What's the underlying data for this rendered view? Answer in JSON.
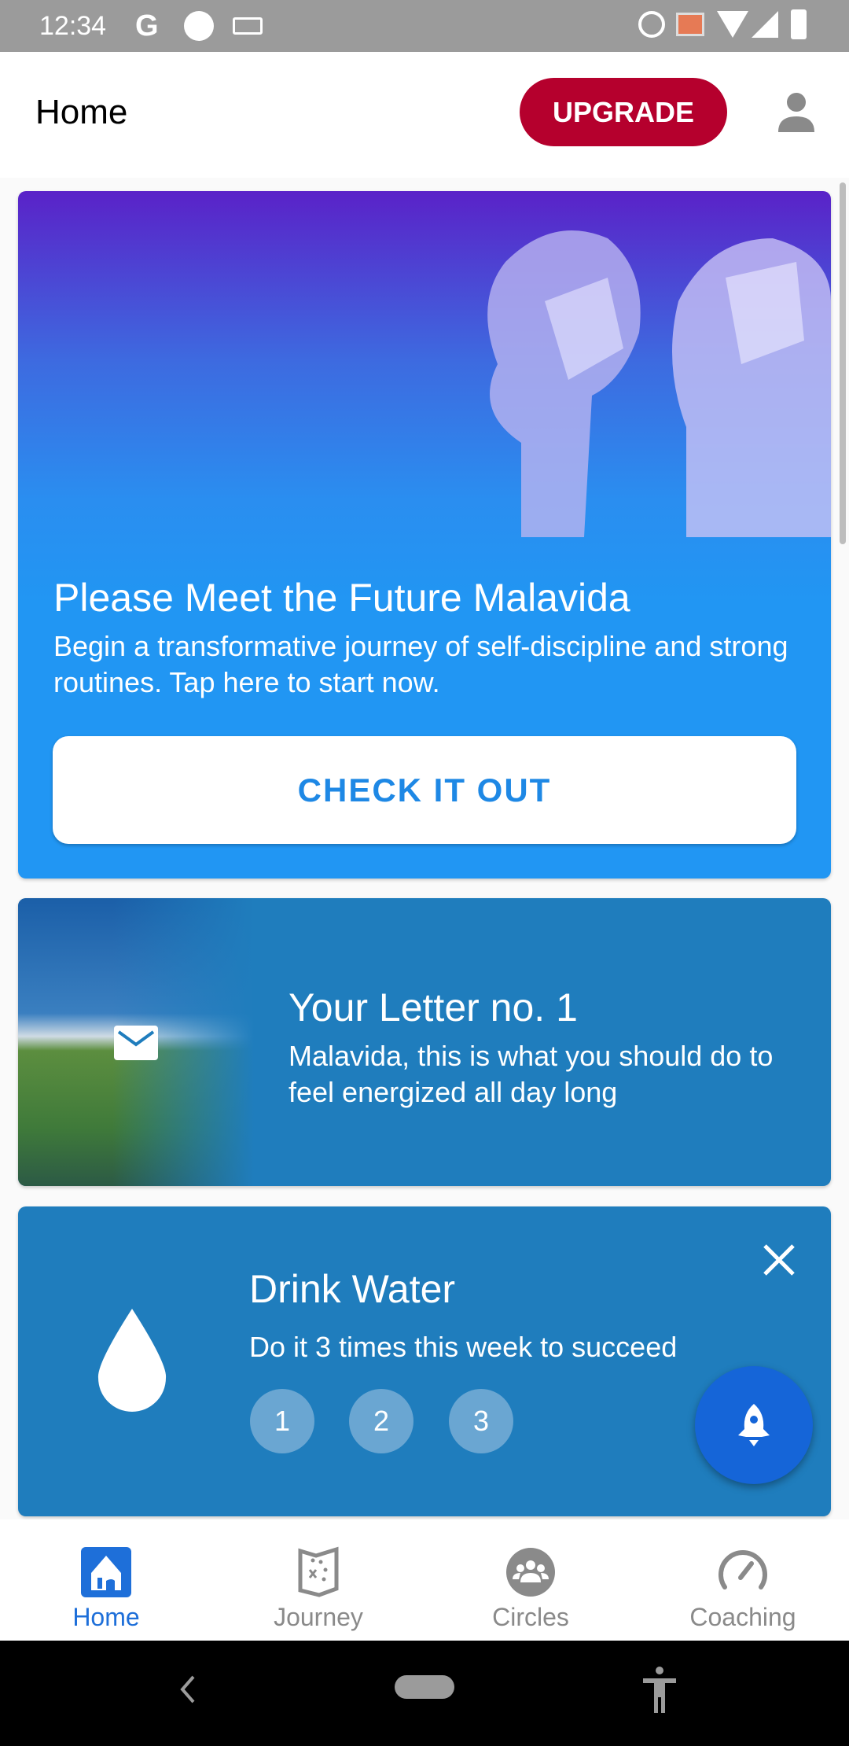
{
  "status_bar": {
    "time": "12:34"
  },
  "header": {
    "title": "Home",
    "upgrade_label": "UPGRADE"
  },
  "promo_card": {
    "title": "Please Meet the Future Malavida",
    "description": "Begin a transformative journey of self-discipline and strong routines. Tap here to start now.",
    "button_label": "CHECK IT OUT"
  },
  "letter_card": {
    "title": "Your Letter no. 1",
    "description": "Malavida, this is what you should do to feel energized all day long",
    "icon": "envelope-icon"
  },
  "habit_card": {
    "title": "Drink Water",
    "description": "Do it 3 times this week to succeed",
    "steps": [
      "1",
      "2",
      "3"
    ],
    "icon": "water-drop-icon"
  },
  "bottom_nav": {
    "items": [
      {
        "label": "Home",
        "icon": "home-icon",
        "active": true
      },
      {
        "label": "Journey",
        "icon": "map-icon"
      },
      {
        "label": "Circles",
        "icon": "group-icon"
      },
      {
        "label": "Coaching",
        "icon": "speedometer-icon"
      }
    ]
  },
  "colors": {
    "accent": "#1e88e5",
    "upgrade": "#b5002d",
    "card": "#1f7dbd",
    "fab": "#1565d8",
    "nav_active": "#1e6fd9"
  }
}
